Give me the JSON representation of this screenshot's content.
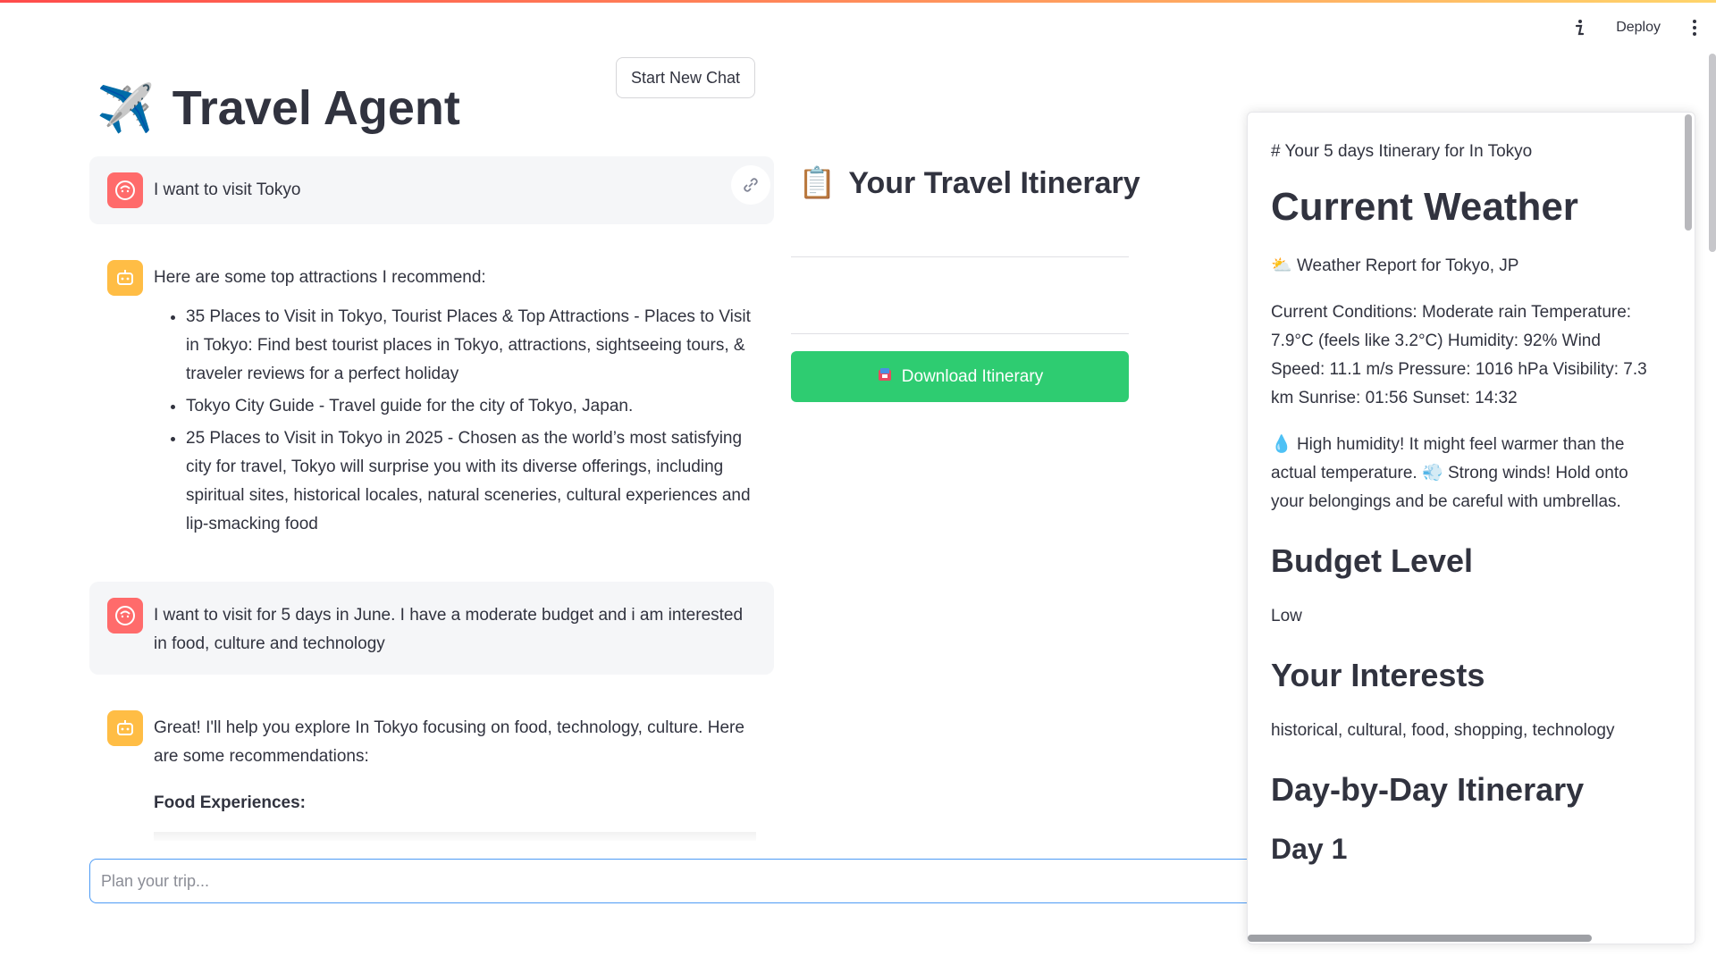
{
  "header": {
    "deploy_label": "Deploy",
    "info_icon": "info-icon",
    "menu_icon": "kebab-menu-icon",
    "accent_gradient": [
      "#ff4b4b",
      "#ffd56b"
    ]
  },
  "app": {
    "title": "Travel Agent",
    "title_emoji": "✈️",
    "new_chat_label": "Start New Chat"
  },
  "chat": {
    "messages": [
      {
        "role": "user",
        "text": "I want to visit Tokyo"
      },
      {
        "role": "assistant",
        "text": "Here are some top attractions I recommend:",
        "items": [
          "35 Places to Visit in Tokyo, Tourist Places & Top Attractions - Places to Visit in Tokyo: Find best tourist places in Tokyo, attractions, sightseeing tours, & traveler reviews for a perfect holiday",
          "Tokyo City Guide - Travel guide for the city of Tokyo, Japan.",
          "25 Places to Visit in Tokyo in 2025 - Chosen as the world’s most satisfying city for travel, Tokyo will surprise you with its diverse offerings, including spiritual sites, historical locales, natural sceneries, cultural experiences and lip-smacking food"
        ]
      },
      {
        "role": "user",
        "text": "I want to visit for 5 days in June. I have a moderate budget and i am interested in food, culture and technology"
      },
      {
        "role": "assistant",
        "text": "Great! I'll help you explore In Tokyo focusing on food, technology, culture. Here are some recommendations:",
        "subheading": "Food Experiences:"
      }
    ],
    "input_placeholder": "Plan your trip..."
  },
  "itinerary": {
    "emoji": "📋",
    "title": "Your Travel Itinerary",
    "download_label": "Download Itinerary",
    "download_color": "#2ecc71"
  },
  "panel": {
    "header_line": "# Your 5 days Itinerary for In Tokyo",
    "weather_heading": "Current Weather",
    "weather_report": "Weather Report for Tokyo, JP",
    "conditions": "Current Conditions: Moderate rain Temperature: 7.9°C (feels like 3.2°C) Humidity: 92% Wind Speed: 11.1 m/s Pressure: 1016 hPa Visibility: 7.3 km Sunrise: 01:56 Sunset: 14:32",
    "humidity_note": "High humidity! It might feel warmer than the actual temperature.",
    "wind_note": "Strong winds! Hold onto your belongings and be careful with umbrellas.",
    "budget_heading": "Budget Level",
    "budget_value": "Low",
    "interests_heading": "Your Interests",
    "interests_value": "historical, cultural, food, shopping, technology",
    "day_heading": "Day-by-Day Itinerary",
    "day1": "Day 1"
  }
}
